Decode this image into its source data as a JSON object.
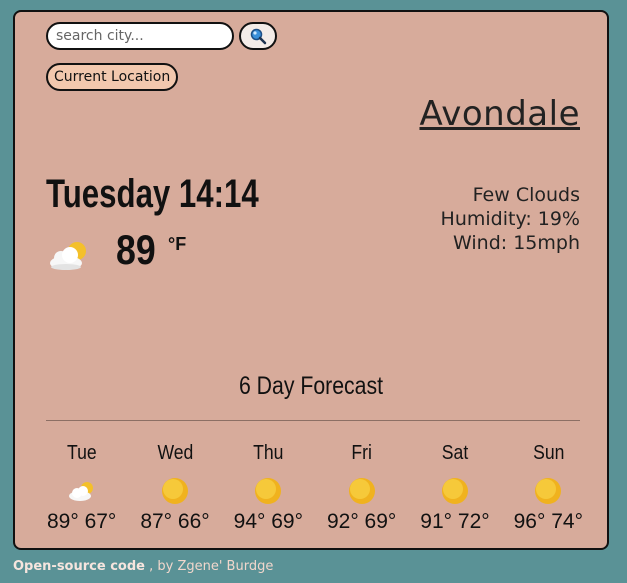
{
  "search": {
    "placeholder": "search city..."
  },
  "buttons": {
    "current_location": "Current Location"
  },
  "city": "Avondale",
  "current": {
    "datetime": "Tuesday 14:14",
    "temperature": "89",
    "unit": "°F",
    "condition": "Few Clouds",
    "humidity": "Humidity: 19%",
    "wind": "Wind: 15mph",
    "icon": "few-clouds-icon"
  },
  "forecast": {
    "title": "6 Day Forecast",
    "days": [
      {
        "day": "Tue",
        "temps": "89° 67°",
        "icon": "few-clouds-icon"
      },
      {
        "day": "Wed",
        "temps": "87° 66°",
        "icon": "sun-icon"
      },
      {
        "day": "Thu",
        "temps": "94° 69°",
        "icon": "sun-icon"
      },
      {
        "day": "Fri",
        "temps": "92° 69°",
        "icon": "sun-icon"
      },
      {
        "day": "Sat",
        "temps": "91° 72°",
        "icon": "sun-icon"
      },
      {
        "day": "Sun",
        "temps": "96° 74°",
        "icon": "sun-icon"
      }
    ]
  },
  "footer": {
    "link": "Open-source code",
    "credit": " , by Zgene' Burdge"
  },
  "colors": {
    "background": "#5a9296",
    "card": "#d7ab9b",
    "location_button": "#f2c8ae",
    "sun": "#f4c02a"
  }
}
